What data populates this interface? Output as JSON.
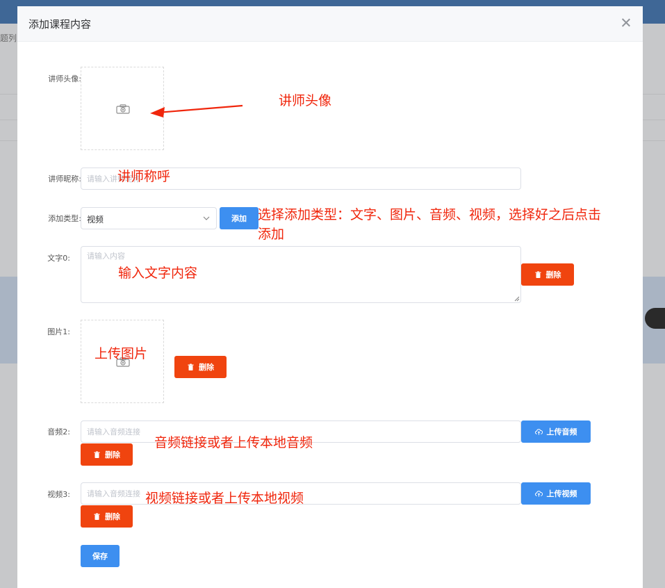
{
  "background": {
    "partial_text": "题列"
  },
  "modal": {
    "title": "添加课程内容",
    "close_label": "×"
  },
  "form": {
    "avatar_label": "讲师头像:",
    "nickname_label": "讲师昵称:",
    "nickname_placeholder": "请输入讲师昵称",
    "type_label": "添加类型:",
    "type_selected": "视频",
    "add_button": "添加",
    "text_label": "文字0:",
    "text_placeholder": "请输入内容",
    "text_delete": "删除",
    "image_label": "图片1:",
    "image_delete": "删除",
    "audio_label": "音频2:",
    "audio_placeholder": "请输入音频连接",
    "audio_upload": "上传音频",
    "audio_delete": "删除",
    "video_label": "视频3:",
    "video_placeholder": "请输入音频连接",
    "video_upload": "上传视频",
    "video_delete": "删除",
    "save_button": "保存"
  },
  "annotations": {
    "avatar": "讲师头像",
    "nickname": "讲师称呼",
    "type_line1": "选择添加类型：文字、图片、音频、视频，选择好之后点击",
    "type_line2": "添加",
    "text": "输入文字内容",
    "image": "上传图片",
    "audio": "音频链接或者上传本地音频",
    "video": "视频链接或者上传本地视频"
  },
  "colors": {
    "primary": "#3d8ff0",
    "danger": "#f0440f",
    "annotation": "#f0260c"
  }
}
